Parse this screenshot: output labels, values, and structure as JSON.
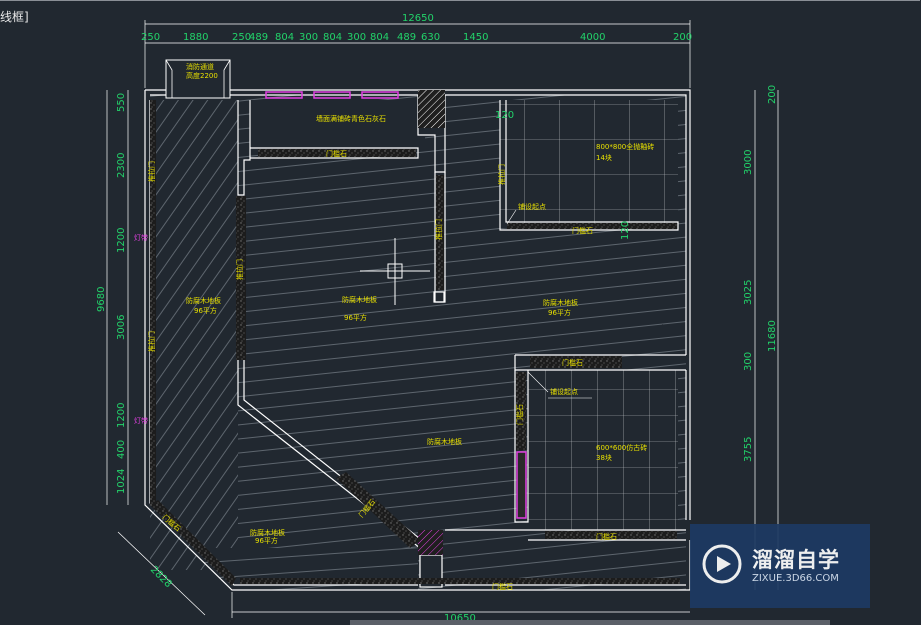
{
  "frame_label": "线框]",
  "dims_top": {
    "total": "12650",
    "parts": [
      "250",
      "1880",
      "250",
      "489",
      "804",
      "300",
      "804",
      "300",
      "804",
      "489",
      "630",
      "1450",
      "4000",
      "200"
    ]
  },
  "dims_left": {
    "total": "9680",
    "parts": [
      "550",
      "2300",
      "1200",
      "3006",
      "1200",
      "400",
      "1024"
    ]
  },
  "dims_right": {
    "total": "11680",
    "parts": [
      "200",
      "3000",
      "3025",
      "300",
      "3755"
    ]
  },
  "dims_bottom": {
    "total": "10650"
  },
  "dims_diag": "2828",
  "dims_inner": {
    "a": "120",
    "b": "120"
  },
  "labels": {
    "fire_exit": "消防通道",
    "fire_exit_width": "高度2200",
    "top_room": "墙面满铺砖青色石灰石",
    "door_stone_top": "门槛石",
    "tile_800": "800*800全抛釉砖",
    "tile_800_count": "14块",
    "tile_start_top": "铺设起点",
    "door_stone_mid": "门槛石",
    "floor_left": "防腐木地板",
    "floor_left_area": "96平方",
    "floor_center": "防腐木地板",
    "floor_center_area": "96平方",
    "floor_right": "防腐木地板",
    "floor_right_area": "96平方",
    "door_stone_right": "门槛石",
    "tile_start_lower": "铺设起点",
    "floor_lower": "防腐木地板",
    "tile_600": "600*600仿古砖",
    "tile_600_count": "38块",
    "floor_bottom": "防腐木地板",
    "floor_bottom_area": "96平方",
    "door_stone_bottom": "门槛石",
    "door_stone_bl": "门槛石",
    "door_stone_diag": "门槛石",
    "door_left1": "推拉门",
    "door_left2": "推拉门",
    "door_mid": "推拉门",
    "door_right1": "推拉门",
    "door_right2": "推拉门",
    "light1": "灯带",
    "light2": "灯带",
    "wall_v": "门槛石",
    "bottom_stone": "门槛石"
  },
  "watermark": {
    "title": "溜溜自学",
    "url": "ZIXUE.3D66.COM"
  },
  "colors": {
    "background": "#212830",
    "dimension": "#22d36a",
    "text": "#e8e000",
    "accent": "#e040e0",
    "wall": "#ffffff"
  }
}
